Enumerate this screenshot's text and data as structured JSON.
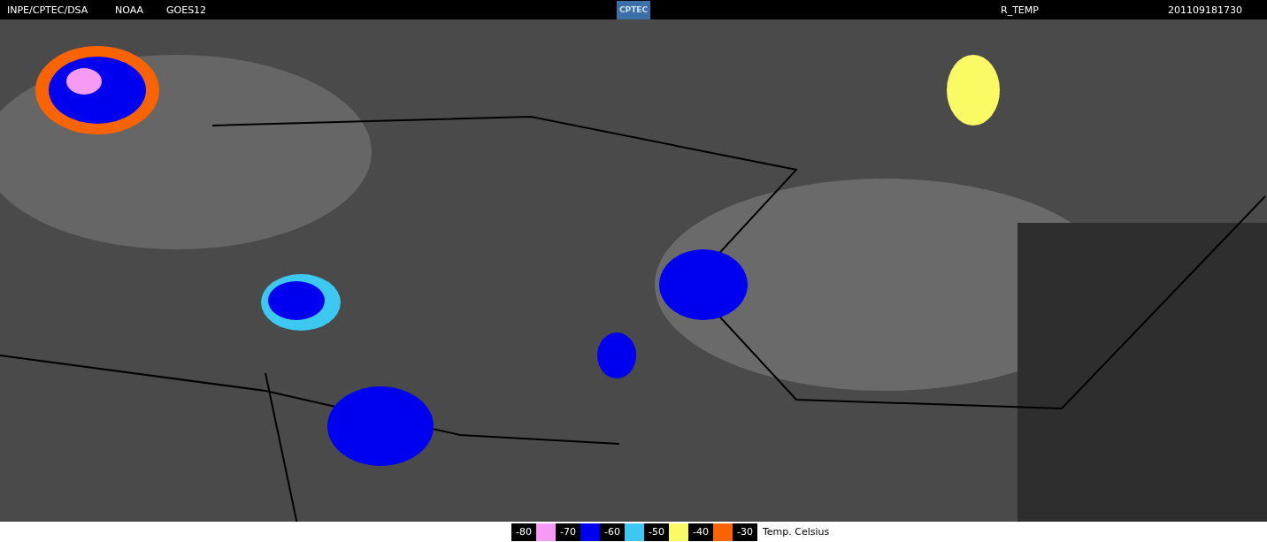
{
  "header": {
    "source": "INPE/CPTEC/DSA",
    "agency": "NOAA",
    "satellite": "GOES12",
    "logo": "CPTEC",
    "product": "R_TEMP",
    "timestamp": "201109181730"
  },
  "legend": {
    "steps": [
      {
        "label": "-80",
        "color": "#f59af5"
      },
      {
        "label": "-70",
        "color": "#0000f0"
      },
      {
        "label": "-60",
        "color": "#3cc8f0"
      },
      {
        "label": "-50",
        "color": "#fafa64"
      },
      {
        "label": "-40",
        "color": "#fa6400"
      },
      {
        "label": "-30"
      }
    ],
    "unit": "Temp. Celsius"
  }
}
